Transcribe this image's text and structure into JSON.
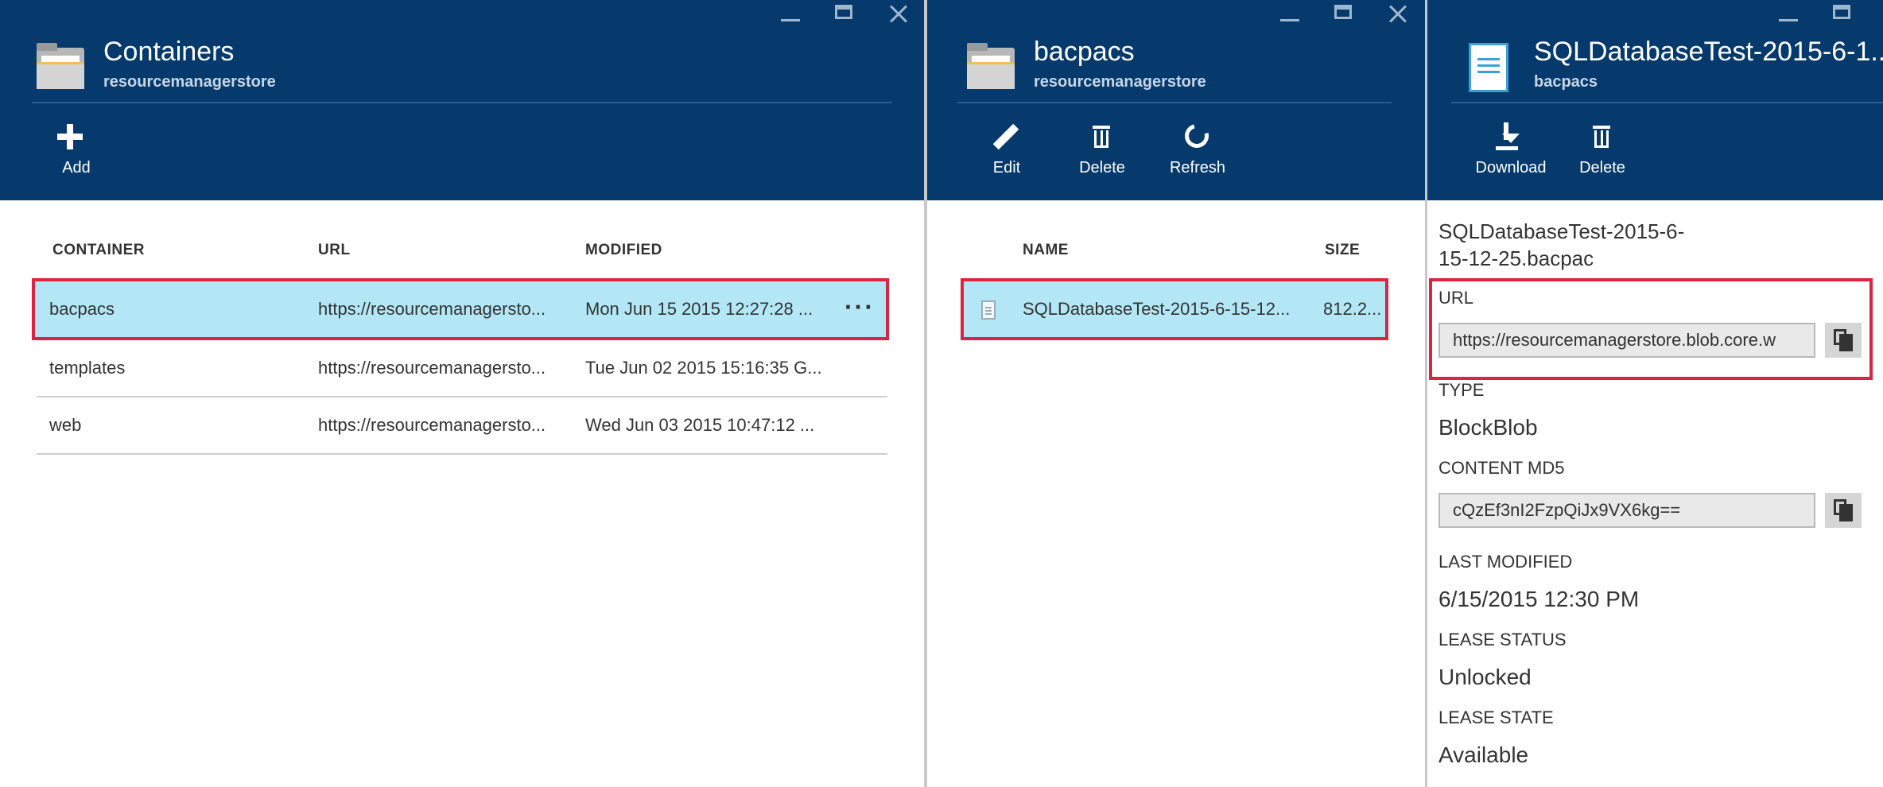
{
  "containers_blade": {
    "title": "Containers",
    "subtitle": "resourcemanagerstore",
    "commands": [
      {
        "label": "Add",
        "icon": "plus-icon"
      }
    ],
    "columns": [
      "CONTAINER",
      "URL",
      "MODIFIED"
    ],
    "rows": [
      {
        "container": "bacpacs",
        "url": "https://resourcemanagersto...",
        "modified": "Mon Jun 15 2015 12:27:28 ...",
        "selected": true
      },
      {
        "container": "templates",
        "url": "https://resourcemanagersto...",
        "modified": "Tue Jun 02 2015 15:16:35 G...",
        "selected": false
      },
      {
        "container": "web",
        "url": "https://resourcemanagersto...",
        "modified": "Wed Jun 03 2015 10:47:12 ...",
        "selected": false
      }
    ],
    "more_label": "···"
  },
  "bacpacs_blade": {
    "title": "bacpacs",
    "subtitle": "resourcemanagerstore",
    "commands": [
      {
        "label": "Edit",
        "icon": "pencil-icon"
      },
      {
        "label": "Delete",
        "icon": "trash-icon"
      },
      {
        "label": "Refresh",
        "icon": "refresh-icon"
      }
    ],
    "columns": [
      "NAME",
      "SIZE"
    ],
    "rows": [
      {
        "name": "SQLDatabaseTest-2015-6-15-12...",
        "size": "812.2...",
        "selected": true
      }
    ]
  },
  "blob_blade": {
    "title": "SQLDatabaseTest-2015-6-1...",
    "subtitle": "bacpacs",
    "commands": [
      {
        "label": "Download",
        "icon": "download-icon"
      },
      {
        "label": "Delete",
        "icon": "trash-icon"
      }
    ],
    "file_name_line1": "SQLDatabaseTest-2015-6-",
    "file_name_line2": "15-12-25.bacpac",
    "url_label": "URL",
    "url_value": "https://resourcemanagerstore.blob.core.w",
    "type_label": "TYPE",
    "type_value": "BlockBlob",
    "md5_label": "CONTENT MD5",
    "md5_value": "cQzEf3nI2FzpQiJx9VX6kg==",
    "modified_label": "LAST MODIFIED",
    "modified_value": "6/15/2015 12:30 PM",
    "lease_status_label": "LEASE STATUS",
    "lease_status_value": "Unlocked",
    "lease_state_label": "LEASE STATE",
    "lease_state_value": "Available"
  },
  "colors": {
    "header_bg": "#063a6c",
    "selection_bg": "#b3e7f6",
    "highlight_border": "#d7263d"
  }
}
